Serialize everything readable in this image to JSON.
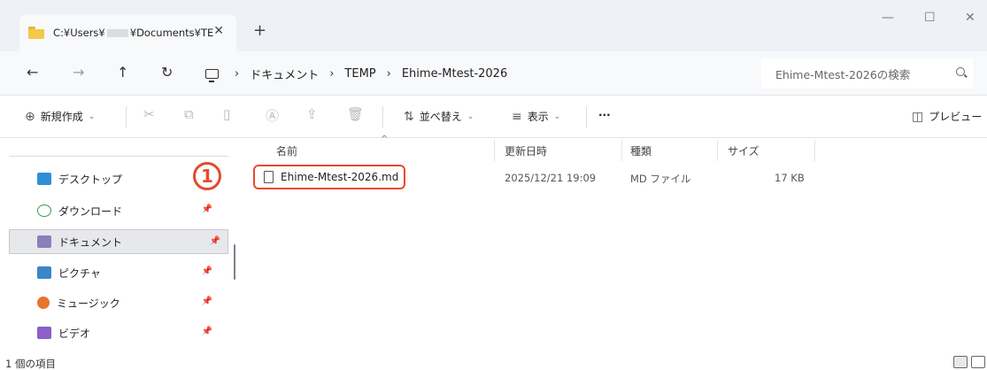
{
  "tab": {
    "title_prefix": "C:¥Users¥",
    "title_suffix": "¥Documents¥TE",
    "close": "✕",
    "new_tab": "+"
  },
  "window": {
    "minimize": "—",
    "maximize": "☐",
    "close": "✕"
  },
  "nav": {
    "back": "←",
    "forward": "→",
    "up": "↑",
    "refresh": "↻"
  },
  "breadcrumb": {
    "separator": "›",
    "items": [
      "ドキュメント",
      "TEMP",
      "Ehime-Mtest-2026"
    ]
  },
  "search": {
    "placeholder": "Ehime-Mtest-2026の検索"
  },
  "toolbar": {
    "new_label": "新規作成",
    "sort_label": "並べ替え",
    "view_label": "表示",
    "more": "···",
    "preview_label": "プレビュー"
  },
  "sidebar": {
    "items": [
      {
        "label": "デスクトップ",
        "icon": "desktop-icon",
        "color": "#2f8fd6",
        "pinned": false
      },
      {
        "label": "ダウンロード",
        "icon": "download-icon",
        "color": "#3b9a4a",
        "pinned": true
      },
      {
        "label": "ドキュメント",
        "icon": "documents-icon",
        "color": "#8a7fb8",
        "pinned": true,
        "selected": true
      },
      {
        "label": "ピクチャ",
        "icon": "pictures-icon",
        "color": "#3a86c8",
        "pinned": true
      },
      {
        "label": "ミュージック",
        "icon": "music-icon",
        "color": "#e8732f",
        "pinned": true
      },
      {
        "label": "ビデオ",
        "icon": "videos-icon",
        "color": "#8d5fc8",
        "pinned": true
      }
    ]
  },
  "columns": {
    "name": "名前",
    "modified": "更新日時",
    "type": "種類",
    "size": "サイズ"
  },
  "files": [
    {
      "name": "Ehime-Mtest-2026.md",
      "modified": "2025/12/21 19:09",
      "type": "MD ファイル",
      "size": "17 KB"
    }
  ],
  "annotation": {
    "step": "1",
    "color": "#e64a2e"
  },
  "status": {
    "item_count": "1 個の項目"
  }
}
